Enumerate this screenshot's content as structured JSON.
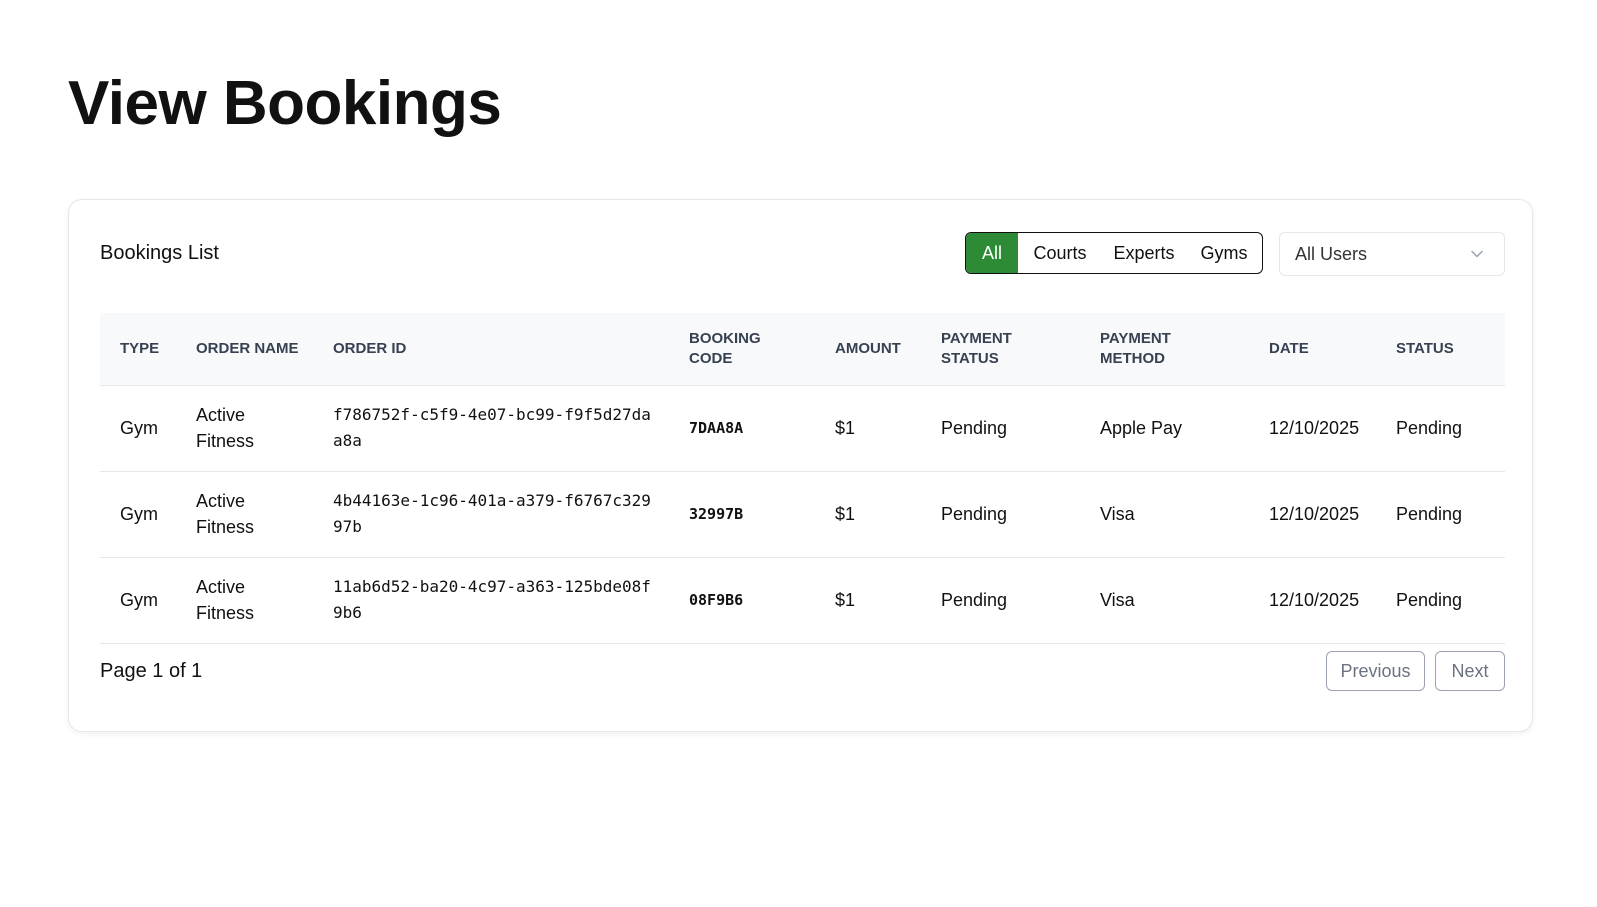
{
  "page": {
    "title": "View Bookings"
  },
  "card": {
    "title": "Bookings List"
  },
  "filters": {
    "segments": [
      "All",
      "Courts",
      "Experts",
      "Gyms"
    ],
    "active_segment": "All",
    "active_color": "#2e8b35",
    "user_select": {
      "value": "All Users",
      "icon": "chevron-down-icon"
    }
  },
  "table": {
    "columns": [
      "TYPE",
      "ORDER NAME",
      "ORDER ID",
      "BOOKING CODE",
      "AMOUNT",
      "PAYMENT STATUS",
      "PAYMENT METHOD",
      "DATE",
      "STATUS"
    ],
    "rows": [
      {
        "type": "Gym",
        "order_name": "Active Fitness",
        "order_id": "f786752f-c5f9-4e07-bc99-f9f5d27daa8a",
        "booking_code": "7DAA8A",
        "amount": "$1",
        "payment_status": "Pending",
        "payment_method": "Apple Pay",
        "date": "12/10/2025",
        "status": "Pending"
      },
      {
        "type": "Gym",
        "order_name": "Active Fitness",
        "order_id": "4b44163e-1c96-401a-a379-f6767c32997b",
        "booking_code": "32997B",
        "amount": "$1",
        "payment_status": "Pending",
        "payment_method": "Visa",
        "date": "12/10/2025",
        "status": "Pending"
      },
      {
        "type": "Gym",
        "order_name": "Active Fitness",
        "order_id": "11ab6d52-ba20-4c97-a363-125bde08f9b6",
        "booking_code": "08F9B6",
        "amount": "$1",
        "payment_status": "Pending",
        "payment_method": "Visa",
        "date": "12/10/2025",
        "status": "Pending"
      }
    ]
  },
  "pagination": {
    "text": "Page 1 of 1",
    "previous_label": "Previous",
    "next_label": "Next"
  }
}
